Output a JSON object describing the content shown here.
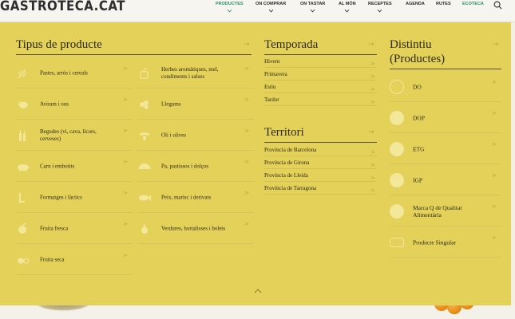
{
  "header": {
    "logo": "GASTROTECA.CAT",
    "nav": [
      {
        "label": "PRODUCTES",
        "has_chevron": true,
        "active": true
      },
      {
        "label": "ON COMPRAR",
        "has_chevron": true
      },
      {
        "label": "ON TASTAR",
        "has_chevron": true
      },
      {
        "label": "AL MÓN",
        "has_chevron": true
      },
      {
        "label": "RECEPTES",
        "has_chevron": true
      },
      {
        "label": "AGENDA",
        "has_chevron": false
      },
      {
        "label": "RUTES",
        "has_chevron": false
      },
      {
        "label": "ECOTECA",
        "has_chevron": false,
        "accent": true
      }
    ],
    "search_icon": "search-icon"
  },
  "menu": {
    "tipus": {
      "title": "Tipus de producte",
      "arrow": "→",
      "left_items": [
        {
          "label": "Pastes, arròs i cereals",
          "icon": "wheat-icon"
        },
        {
          "label": "Aviram i ous",
          "icon": "chicken-icon"
        },
        {
          "label": "Begudes (vi, cava, licors, cerveses)",
          "icon": "bottles-icon"
        },
        {
          "label": "Carn i embotits",
          "icon": "pig-icon"
        },
        {
          "label": "Formatges i làctics",
          "icon": "milk-icon"
        },
        {
          "label": "Fruita fresca",
          "icon": "fruit-icon"
        },
        {
          "label": "Fruita seca",
          "icon": "nuts-icon"
        }
      ],
      "right_items": [
        {
          "label": "Herbes aromàtiques, mel, condiments i salses",
          "icon": "herbs-icon"
        },
        {
          "label": "Llegums",
          "icon": "legumes-icon"
        },
        {
          "label": "Oli i olives",
          "icon": "olive-icon"
        },
        {
          "label": "Pa, pastissos i dolços",
          "icon": "bread-icon"
        },
        {
          "label": "Peix, marisc i derivats",
          "icon": "fish-icon"
        },
        {
          "label": "Verdures, hortalisses i bolets",
          "icon": "vegetable-icon"
        }
      ]
    },
    "temporada": {
      "title": "Temporada",
      "arrow": "→",
      "items": [
        "Hivern",
        "Primavera",
        "Estiu",
        "Tardor"
      ]
    },
    "territori": {
      "title": "Territori",
      "arrow": "→",
      "items": [
        "Província de Barcelona",
        "Província de Girona",
        "Província de Lleida",
        "Província de Tarragona"
      ]
    },
    "distintiu": {
      "title_line1": "Distintiu",
      "title_line2": "(Productes)",
      "arrow": "→",
      "items": [
        {
          "label": "DO",
          "icon": "do-badge-icon"
        },
        {
          "label": "DOP",
          "icon": "dop-badge-icon"
        },
        {
          "label": "ETG",
          "icon": "etg-badge-icon"
        },
        {
          "label": "IGP",
          "icon": "igp-badge-icon"
        },
        {
          "label": "Marca Q de Qualitat Alimentària",
          "icon": "q-badge-icon"
        },
        {
          "label": "Producte Singular",
          "icon": "singular-badge-icon"
        }
      ]
    },
    "item_arrow": ">",
    "collapse_icon": "chevron-up-icon"
  },
  "colors": {
    "panel": "#e3d15a",
    "accent": "#2a8f6c",
    "text": "#2d2a1a"
  }
}
